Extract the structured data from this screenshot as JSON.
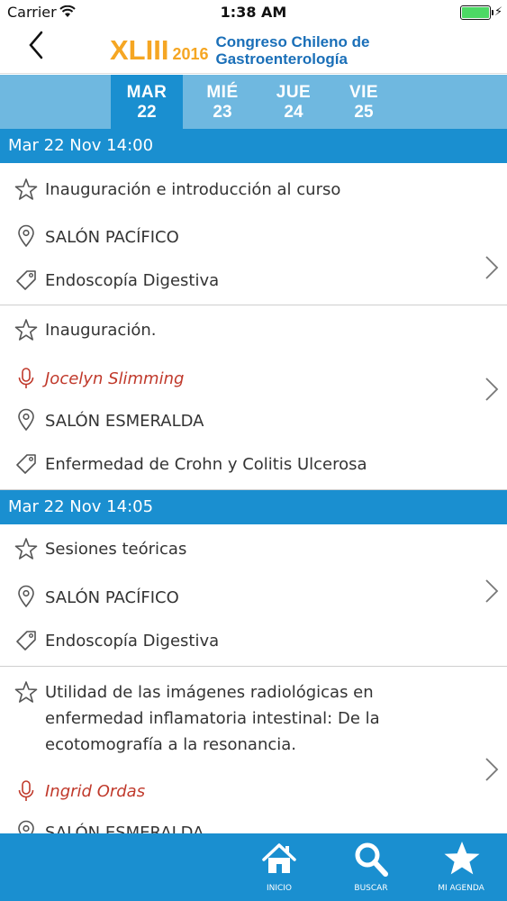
{
  "status_bar": {
    "carrier": "Carrier",
    "time": "1:38 AM"
  },
  "header": {
    "logo_roman": "XLIII",
    "logo_year": "2016",
    "logo_line1": "Congreso Chileno de",
    "logo_line2": "Gastroenterología"
  },
  "day_tabs": [
    {
      "name": "MAR",
      "num": "22",
      "active": true
    },
    {
      "name": "MIÉ",
      "num": "23",
      "active": false
    },
    {
      "name": "JUE",
      "num": "24",
      "active": false
    },
    {
      "name": "VIE",
      "num": "25",
      "active": false
    }
  ],
  "sections": [
    {
      "time": "Mar 22 Nov 14:00",
      "events": [
        {
          "title": "Inauguración e introducción al curso",
          "speaker": "",
          "room": "SALÓN PACÍFICO",
          "topic": "Endoscopía Digestiva"
        },
        {
          "title": "Inauguración.",
          "speaker": "Jocelyn Slimming",
          "room": "SALÓN ESMERALDA",
          "topic": "Enfermedad de Crohn y Colitis Ulcerosa"
        }
      ]
    },
    {
      "time": "Mar 22 Nov 14:05",
      "events": [
        {
          "title": "Sesiones teóricas",
          "speaker": "",
          "room": "SALÓN PACÍFICO",
          "topic": "Endoscopía Digestiva"
        },
        {
          "title_lines": [
            "Utilidad de las imágenes radiológicas en",
            "enfermedad inflamatoria intestinal: De la",
            "ecotomografía a la resonancia."
          ],
          "speaker": "Ingrid Ordas",
          "room": "SALÓN ESMERALDA",
          "topic": ""
        }
      ]
    }
  ],
  "tabbar": {
    "home": "INICIO",
    "search": "BUSCAR",
    "agenda": "MI AGENDA"
  },
  "colors": {
    "primary": "#1a8fd0",
    "tab_strip": "#6fb8e0",
    "logo_orange": "#f5a623",
    "logo_blue": "#1a6fb8",
    "speaker": "#c0392b"
  }
}
